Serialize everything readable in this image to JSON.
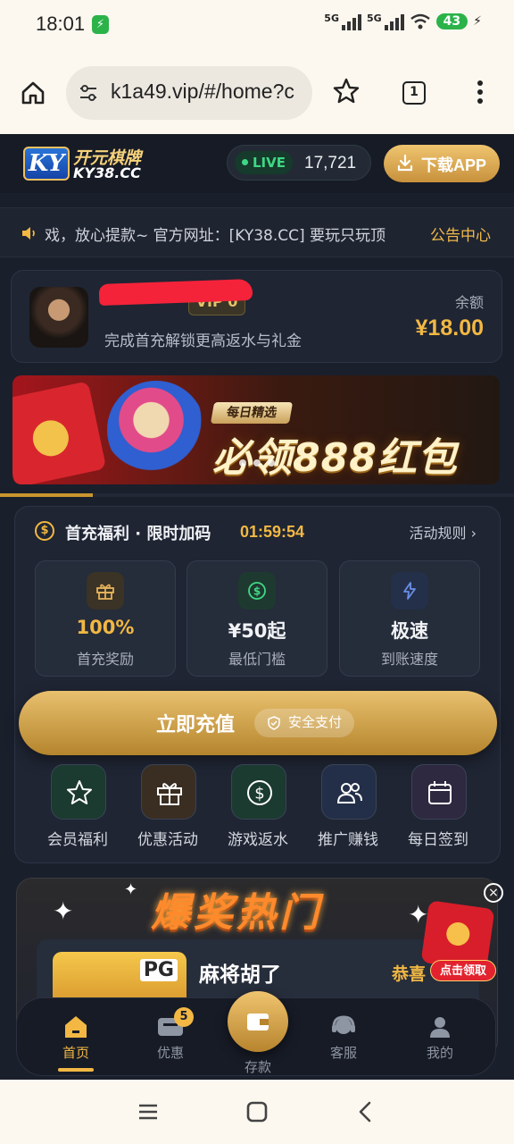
{
  "status_bar": {
    "time": "18:01",
    "signal1": "5G",
    "signal2": "5G",
    "battery": "43"
  },
  "browser": {
    "url": "k1a49.vip/#/home?c",
    "tab_count": "1"
  },
  "header": {
    "logo_badge": "KY",
    "logo_name": "开元棋牌",
    "logo_sub": "KY38.CC",
    "live_label": "LIVE",
    "live_count": "17,721",
    "download_label": "下载APP"
  },
  "notice": {
    "text": "戏，放心提款~    官方网址：[KY38.CC] 要玩只玩顶",
    "center_link": "公告中心"
  },
  "account": {
    "vip": "VIP 0",
    "promo": "完成首充解锁更高返水与礼金",
    "balance_label": "余额",
    "balance": "¥18.00"
  },
  "banner": {
    "chip": "每日精选",
    "title": "必领888红包",
    "progress": 0.18
  },
  "recharge": {
    "title": "首充福利 · 限时加码",
    "timer": "01:59:54",
    "rules": "活动规则 ›",
    "stats": [
      {
        "value": "100%",
        "label": "首充奖励",
        "value_color": "#f2b843",
        "icon": "gift-icon"
      },
      {
        "value": "¥50起",
        "label": "最低门槛",
        "value_color": "#f2f3f6",
        "icon": "dollar-icon"
      },
      {
        "value": "极速",
        "label": "到账速度",
        "value_color": "#f2f3f6",
        "icon": "lightning-icon"
      }
    ],
    "button_label": "立即充值",
    "secure_label": "安全支付",
    "quick": [
      {
        "label": "会员福利",
        "icon": "star-icon"
      },
      {
        "label": "优惠活动",
        "icon": "gift-icon"
      },
      {
        "label": "游戏返水",
        "icon": "dollar-icon"
      },
      {
        "label": "推广赚钱",
        "icon": "users-icon"
      },
      {
        "label": "每日签到",
        "icon": "calendar-icon"
      }
    ]
  },
  "jackpot": {
    "title": "爆奖热门",
    "game_tag": "PG",
    "game_name": "麻将胡了",
    "congrats": "恭喜",
    "claim": "点击领取"
  },
  "tabbar": {
    "home": "首页",
    "promo": "优惠",
    "promo_badge": "5",
    "deposit": "存款",
    "service": "客服",
    "me": "我的"
  },
  "colors": {
    "accent": "#f2b843",
    "bg": "#1a1f2c",
    "live": "#3fd884"
  }
}
